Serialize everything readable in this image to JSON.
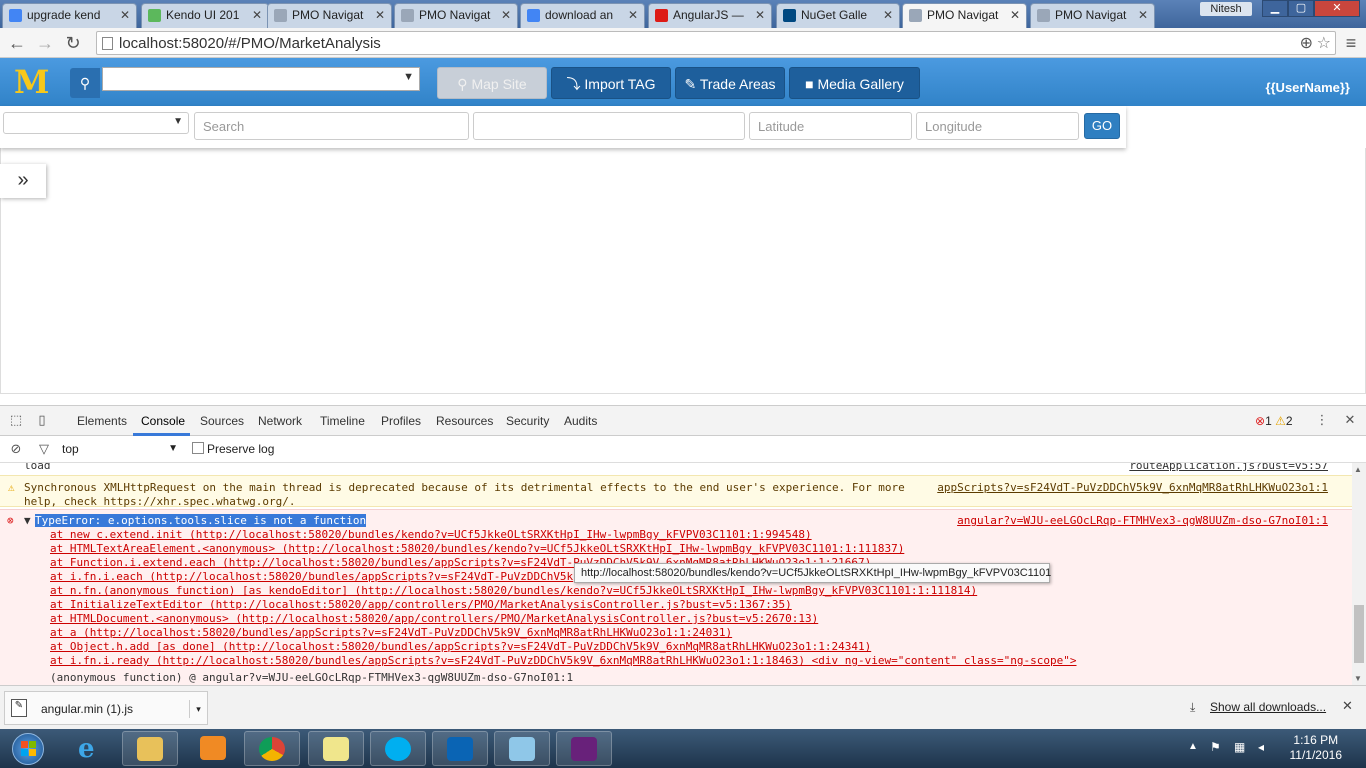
{
  "browser": {
    "tabs": [
      {
        "label": "upgrade kend",
        "color": "#4285f4"
      },
      {
        "label": "Kendo UI 201",
        "color": "#5cb85c"
      },
      {
        "label": "PMO Navigat",
        "color": "#9aa7b8"
      },
      {
        "label": "PMO Navigat",
        "color": "#9aa7b8"
      },
      {
        "label": "download an",
        "color": "#4285f4"
      },
      {
        "label": "AngularJS —",
        "color": "#dd1b16"
      },
      {
        "label": "NuGet Galle",
        "color": "#004880"
      },
      {
        "label": "PMO Navigat",
        "color": "#9aa7b8"
      },
      {
        "label": "PMO Navigat",
        "color": "#9aa7b8"
      }
    ],
    "user": "Nitesh",
    "url": "localhost:58020/#/PMO/MarketAnalysis"
  },
  "app": {
    "logo": "M",
    "nav": {
      "map_site": "Map Site",
      "import_tag": "Import TAG",
      "trade_areas": "Trade Areas",
      "media_gallery": "Media Gallery"
    },
    "username": "{{UserName}}",
    "search": {
      "placeholder": "Search",
      "latitude": "Latitude",
      "longitude": "Longitude",
      "go": "GO"
    },
    "expand": "»"
  },
  "devtools": {
    "tabs": [
      "Elements",
      "Console",
      "Sources",
      "Network",
      "Timeline",
      "Profiles",
      "Resources",
      "Security",
      "Audits"
    ],
    "active_tab": "Console",
    "errors": "1",
    "warnings": "2",
    "context": "top",
    "preserve_log": "Preserve log",
    "partial_top": "load",
    "partial_top_src": "routeApplication.js?bust=v5:57",
    "warning": {
      "line1": "Synchronous XMLHttpRequest on the main thread is deprecated because of its detrimental effects to the end user's experience. For more",
      "line2": "help, check https://xhr.spec.whatwg.org/.",
      "src": "appScripts?v=sF24VdT-PuVzDDChV5k9V_6xnMqMR8atRhLHKWuO23o1:1"
    },
    "error": {
      "message": "TypeError: e.options.tools.slice is not a function",
      "src": "angular?v=WJU-eeLGOcLRqp-FTMHVex3-qgW8UUZm-dso-G7noI01:1",
      "stack": [
        "at new c.extend.init (http://localhost:58020/bundles/kendo?v=UCf5JkkeOLtSRXKtHpI_IHw-lwpmBgy_kFVPV03C1101:1:994548)",
        "at HTMLTextAreaElement.<anonymous> (http://localhost:58020/bundles/kendo?v=UCf5JkkeOLtSRXKtHpI_IHw-lwpmBgy_kFVPV03C1101:1:111837)",
        "at Function.i.extend.each (http://localhost:58020/bundles/appScripts?v=sF24VdT-PuVzDDChV5k9V_6xnMqMR8atRhLHKWuO23o1:1:21667)",
        "at i.fn.i.each (http://localhost:58020/bundles/appScripts?v=sF24VdT-PuVzDDChV5k",
        "at n.fn.(anonymous function) [as kendoEditor] (http://localhost:58020/bundles/kendo?v=UCf5JkkeOLtSRXKtHpI_IHw-lwpmBgy_kFVPV03C1101:1:111814)",
        "at InitializeTextEditor (http://localhost:58020/app/controllers/PMO/MarketAnalysisController.js?bust=v5:1367:35)",
        "at HTMLDocument.<anonymous> (http://localhost:58020/app/controllers/PMO/MarketAnalysisController.js?bust=v5:2670:13)",
        "at a (http://localhost:58020/bundles/appScripts?v=sF24VdT-PuVzDDChV5k9V_6xnMqMR8atRhLHKWuO23o1:1:24031)",
        "at Object.h.add [as done] (http://localhost:58020/bundles/appScripts?v=sF24VdT-PuVzDDChV5k9V_6xnMqMR8atRhLHKWuO23o1:1:24341)",
        "at i.fn.i.ready (http://localhost:58020/bundles/appScripts?v=sF24VdT-PuVzDDChV5k9V_6xnMqMR8atRhLHKWuO23o1:1:18463) <div ng-view=\"content\" class=\"ng-scope\">"
      ],
      "footer": "(anonymous function) @ angular?v=WJU-eeLGOcLRqp-FTMHVex3-qgW8UUZm-dso-G7noI01:1"
    },
    "tooltip": "http://localhost:58020/bundles/kendo?v=UCf5JkkeOLtSRXKtHpI_IHw-lwpmBgy_kFVPV03C1101"
  },
  "downloads": {
    "file": "angular.min (1).js",
    "show_all": "Show all downloads..."
  },
  "taskbar": {
    "time": "1:16 PM",
    "date": "11/1/2016"
  }
}
